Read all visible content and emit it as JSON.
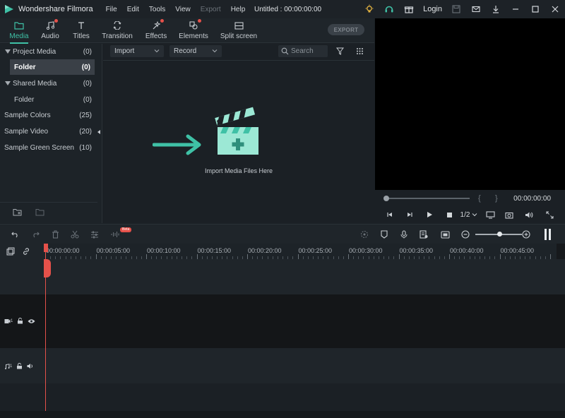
{
  "app": {
    "name": "Wondershare Filmora",
    "document_title": "Untitled : 00:00:00:00",
    "menu": [
      "File",
      "Edit",
      "Tools",
      "View",
      "Export",
      "Help"
    ],
    "login_label": "Login"
  },
  "media_tabs": [
    {
      "label": "Media",
      "icon": "folder-icon",
      "active": true,
      "dot": false
    },
    {
      "label": "Audio",
      "icon": "music-note-icon",
      "active": false,
      "dot": true
    },
    {
      "label": "Titles",
      "icon": "text-icon",
      "active": false,
      "dot": false
    },
    {
      "label": "Transition",
      "icon": "transition-icon",
      "active": false,
      "dot": false
    },
    {
      "label": "Effects",
      "icon": "effects-icon",
      "active": false,
      "dot": true
    },
    {
      "label": "Elements",
      "icon": "elements-icon",
      "active": false,
      "dot": true
    },
    {
      "label": "Split screen",
      "icon": "split-screen-icon",
      "active": false,
      "dot": false
    }
  ],
  "export_label": "EXPORT",
  "library": [
    {
      "label": "Project Media",
      "count": "(0)",
      "expandable": true,
      "indent": 0,
      "selected": false
    },
    {
      "label": "Folder",
      "count": "(0)",
      "expandable": false,
      "indent": 1,
      "selected": true
    },
    {
      "label": "Shared Media",
      "count": "(0)",
      "expandable": true,
      "indent": 0,
      "selected": false
    },
    {
      "label": "Folder",
      "count": "(0)",
      "expandable": false,
      "indent": 1,
      "selected": false
    },
    {
      "label": "Sample Colors",
      "count": "(25)",
      "expandable": false,
      "indent": -1,
      "selected": false
    },
    {
      "label": "Sample Video",
      "count": "(20)",
      "expandable": false,
      "indent": -1,
      "selected": false
    },
    {
      "label": "Sample Green Screen",
      "count": "(10)",
      "expandable": false,
      "indent": -1,
      "selected": false
    }
  ],
  "media": {
    "import_label": "Import",
    "record_label": "Record",
    "search_placeholder": "Search",
    "import_hint": "Import Media Files Here"
  },
  "preview": {
    "timecode": "00:00:00:00",
    "ratio": "1/2"
  },
  "timeline": {
    "ruler_labels": [
      "00:00:00:00",
      "00:00:05:00",
      "00:00:10:00",
      "00:00:15:00",
      "00:00:20:00",
      "00:00:25:00",
      "00:00:30:00",
      "00:00:35:00",
      "00:00:40:00",
      "00:00:45:00"
    ],
    "beta_label": "Beta",
    "video_track_num": "1",
    "audio_track_num": "1"
  },
  "colors": {
    "accent": "#3fc1a6",
    "notification": "#e5514a",
    "playhead": "#e5514a"
  }
}
